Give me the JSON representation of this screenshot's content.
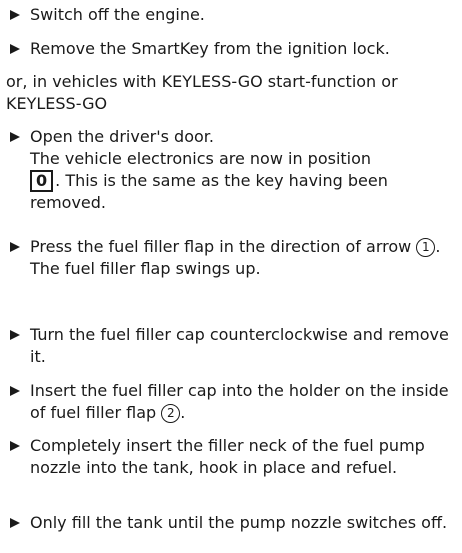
{
  "steps": {
    "s1": "Switch off the engine.",
    "s2": "Remove the SmartKey from the ignition lock.",
    "alt": "or, in vehicles with KEYLESS-GO start-function or KEYLESS-GO",
    "s3": "Open the driver's door.",
    "s3_result_a": "The vehicle electronics are now in position",
    "s3_key": "0",
    "s3_result_b": ". This is the same as the key having been removed.",
    "s4_a": "Press the fuel filler flap in the direction of arrow",
    "s4_marker": "1",
    "s4_b": ".",
    "s4_result": "The fuel filler flap swings up.",
    "s5": "Turn the fuel filler cap counterclockwise and remove it.",
    "s6_a": "Insert the fuel filler cap into the holder on the inside of fuel filler flap",
    "s6_marker": "2",
    "s6_b": ".",
    "s7": "Completely insert the filler neck of the fuel pump nozzle into the tank, hook in place and refuel.",
    "s8": "Only fill the tank until the pump nozzle switches off."
  }
}
